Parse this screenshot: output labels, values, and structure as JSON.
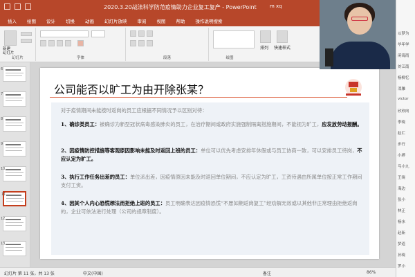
{
  "window": {
    "title": "2020.3.20战法科学防范疫情助力企业复工复产 - PowerPoint",
    "user": "m xq",
    "controls": [
      "—",
      "□",
      "✕"
    ]
  },
  "tabs": [
    "插入",
    "绘图",
    "设计",
    "切换",
    "动画",
    "幻灯片放映",
    "审阅",
    "视图",
    "帮助",
    "操作说明搜索"
  ],
  "ribbon_groups": [
    "幻灯片",
    "字体",
    "段落",
    "绘图"
  ],
  "ribbon_labels": {
    "new_slide": "新建\n幻灯片",
    "arrange": "排列",
    "quick_styles": "快速样式"
  },
  "thumbnails": [
    "6",
    "7",
    "8",
    "9",
    "10",
    "11",
    "12",
    "13"
  ],
  "slide": {
    "title": "公司能否以旷工为由开除张某？",
    "intro": "对于疫情期间未能按时返岗的员工应根据不同情况予以区别对待：",
    "items": [
      {
        "head": "1、确诊类员工：",
        "body": "被确诊为新型冠状病毒感染肺炎的员工，在治疗期间或政府实施强制隔离措施期间，不能视为旷工，",
        "tail": "应发放劳动报酬。"
      },
      {
        "head": "2、因疫情防控措施等客观原因影响未能及时返回上班的员工：",
        "body": "单位可以优先考虑安排年休假或与员工协商一致，可以安排员工待岗，",
        "tail": "不应认定为旷工。"
      },
      {
        "head": "3、执行工作任务出差的员工：",
        "body": "单位派出差，因疫情原因未能及时返回单位期间，不应认定为旷工，工资待遇由所属单位按正常工作期间支付工资。",
        "tail": ""
      },
      {
        "head": "4、因其个人内心恐慌想法而拒绝上班的员工：",
        "body": "员工明确表达因疫情恐慌“不愿如期返岗复工”经劝解无效或以其他非正常理由拒绝返岗的，企业可依法进行处理（公司的规章制度）。",
        "tail": ""
      }
    ]
  },
  "status": {
    "slide_info": "幻灯片 第 11 张，共 13 张",
    "lang": "中文(中国)",
    "notes": "备注",
    "zoom": "86%"
  },
  "chat_list": [
    "以梦为",
    "华年学",
    "闲海雨",
    "刘江南",
    "杨柳忆",
    "漆雕",
    "victor",
    "欣欣向",
    "李晓",
    "赵汇",
    "步行",
    "小婷",
    "弓小九",
    "王晓",
    "海边",
    "张小",
    "林正",
    "杨水",
    "赵新",
    "梦道",
    "孙晓",
    "罗小"
  ],
  "colors": {
    "accent": "#b7472a",
    "title_rule": "#e06a4b"
  }
}
